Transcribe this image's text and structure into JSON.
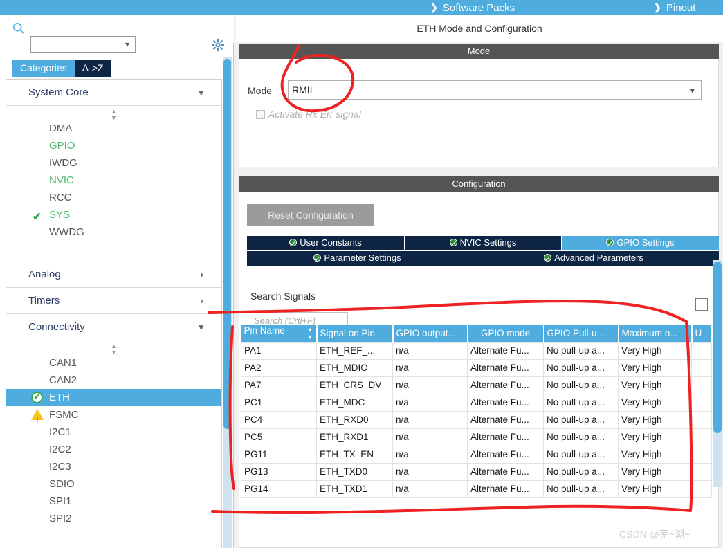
{
  "topbar": {
    "items": [
      {
        "label": "Software Packs",
        "icon": "chevron-down-icon"
      },
      {
        "label": "Pinout",
        "icon": "chevron-down-icon"
      }
    ]
  },
  "sidebar": {
    "search": {
      "value": "",
      "placeholder": ""
    },
    "icons": {
      "search": "search-icon",
      "settings": "gear-icon"
    },
    "tabs": [
      {
        "label": "Categories",
        "selected": true
      },
      {
        "label": "A->Z",
        "selected": false
      }
    ],
    "groups": [
      {
        "name": "System Core",
        "expanded": true,
        "items": [
          {
            "label": "DMA",
            "state": "normal"
          },
          {
            "label": "GPIO",
            "state": "configured"
          },
          {
            "label": "IWDG",
            "state": "normal"
          },
          {
            "label": "NVIC",
            "state": "configured"
          },
          {
            "label": "RCC",
            "state": "normal"
          },
          {
            "label": "SYS",
            "state": "configured",
            "badge": "check"
          },
          {
            "label": "WWDG",
            "state": "normal"
          }
        ]
      },
      {
        "name": "Analog",
        "expanded": false,
        "items": []
      },
      {
        "name": "Timers",
        "expanded": false,
        "items": []
      },
      {
        "name": "Connectivity",
        "expanded": true,
        "items": [
          {
            "label": "CAN1",
            "state": "normal"
          },
          {
            "label": "CAN2",
            "state": "normal"
          },
          {
            "label": "ETH",
            "state": "selected",
            "badge": "ok"
          },
          {
            "label": "FSMC",
            "state": "normal",
            "badge": "warning"
          },
          {
            "label": "I2C1",
            "state": "normal"
          },
          {
            "label": "I2C2",
            "state": "normal"
          },
          {
            "label": "I2C3",
            "state": "normal"
          },
          {
            "label": "SDIO",
            "state": "normal"
          },
          {
            "label": "SPI1",
            "state": "normal"
          },
          {
            "label": "SPI2",
            "state": "normal"
          }
        ]
      }
    ]
  },
  "main": {
    "title": "ETH Mode and Configuration",
    "mode_panel": {
      "header": "Mode",
      "mode_label": "Mode",
      "mode_value": "RMII",
      "checkbox_label": "Activate Rx Err signal",
      "checkbox_checked": false,
      "checkbox_enabled": false
    },
    "config_panel": {
      "header": "Configuration",
      "reset_button": "Reset Configuration",
      "tabs_row1": [
        {
          "label": "User Constants",
          "active": false
        },
        {
          "label": "NVIC Settings",
          "active": false
        },
        {
          "label": "GPIO Settings",
          "active": true
        }
      ],
      "tabs_row2": [
        {
          "label": "Parameter Settings",
          "active": false
        },
        {
          "label": "Advanced Parameters",
          "active": false
        }
      ],
      "search_label": "Search Signals",
      "search_placeholder": "Search (Crtl+F)",
      "search_value": ""
    },
    "table": {
      "columns": [
        "Pin Name",
        "Signal on Pin",
        "GPIO output...",
        "GPIO mode",
        "GPIO Pull-u...",
        "Maximum o...",
        "U"
      ],
      "sort_column": "Pin Name",
      "rows": [
        [
          "PA1",
          "ETH_REF_...",
          "n/a",
          "Alternate Fu...",
          "No pull-up a...",
          "Very High",
          ""
        ],
        [
          "PA2",
          "ETH_MDIO",
          "n/a",
          "Alternate Fu...",
          "No pull-up a...",
          "Very High",
          ""
        ],
        [
          "PA7",
          "ETH_CRS_DV",
          "n/a",
          "Alternate Fu...",
          "No pull-up a...",
          "Very High",
          ""
        ],
        [
          "PC1",
          "ETH_MDC",
          "n/a",
          "Alternate Fu...",
          "No pull-up a...",
          "Very High",
          ""
        ],
        [
          "PC4",
          "ETH_RXD0",
          "n/a",
          "Alternate Fu...",
          "No pull-up a...",
          "Very High",
          ""
        ],
        [
          "PC5",
          "ETH_RXD1",
          "n/a",
          "Alternate Fu...",
          "No pull-up a...",
          "Very High",
          ""
        ],
        [
          "PG11",
          "ETH_TX_EN",
          "n/a",
          "Alternate Fu...",
          "No pull-up a...",
          "Very High",
          ""
        ],
        [
          "PG13",
          "ETH_TXD0",
          "n/a",
          "Alternate Fu...",
          "No pull-up a...",
          "Very High",
          ""
        ],
        [
          "PG14",
          "ETH_TXD1",
          "n/a",
          "Alternate Fu...",
          "No pull-up a...",
          "Very High",
          ""
        ]
      ]
    }
  },
  "watermark": "CSDN @芜~湖~",
  "colors": {
    "accent_blue": "#4eadde",
    "tab_navy": "#0e2545",
    "panel_header_gray": "#555555",
    "annotation_red": "#ee2222",
    "configured_green": "#4cb96b",
    "warning_yellow": "#f5c518"
  }
}
